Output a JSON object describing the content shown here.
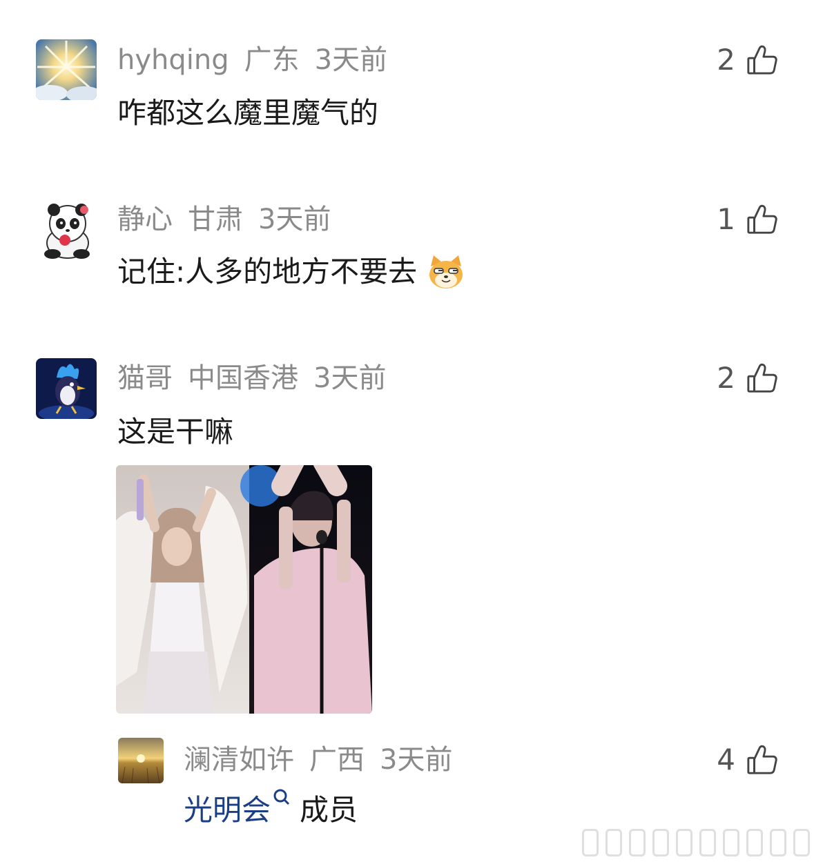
{
  "comments": [
    {
      "username": "hyhqing",
      "location": "广东",
      "time": "3天前",
      "likes": "2",
      "text": "咋都这么魔里魔气的"
    },
    {
      "username": "静心",
      "location": "甘肃",
      "time": "3天前",
      "likes": "1",
      "text": "记住:人多的地方不要去"
    },
    {
      "username": "猫哥",
      "location": "中国香港",
      "time": "3天前",
      "likes": "2",
      "text": "这是干嘛"
    }
  ],
  "reply": {
    "username": "澜清如许",
    "location": "广西",
    "time": "3天前",
    "likes": "4",
    "link_text": "光明会",
    "text_suffix": "成员"
  },
  "colors": {
    "meta": "#8a8a8a",
    "text": "#1a1a1a",
    "link": "#1a3f86"
  },
  "icons": [
    "thumbs-up-icon",
    "search-icon",
    "dog-emoji-icon"
  ]
}
